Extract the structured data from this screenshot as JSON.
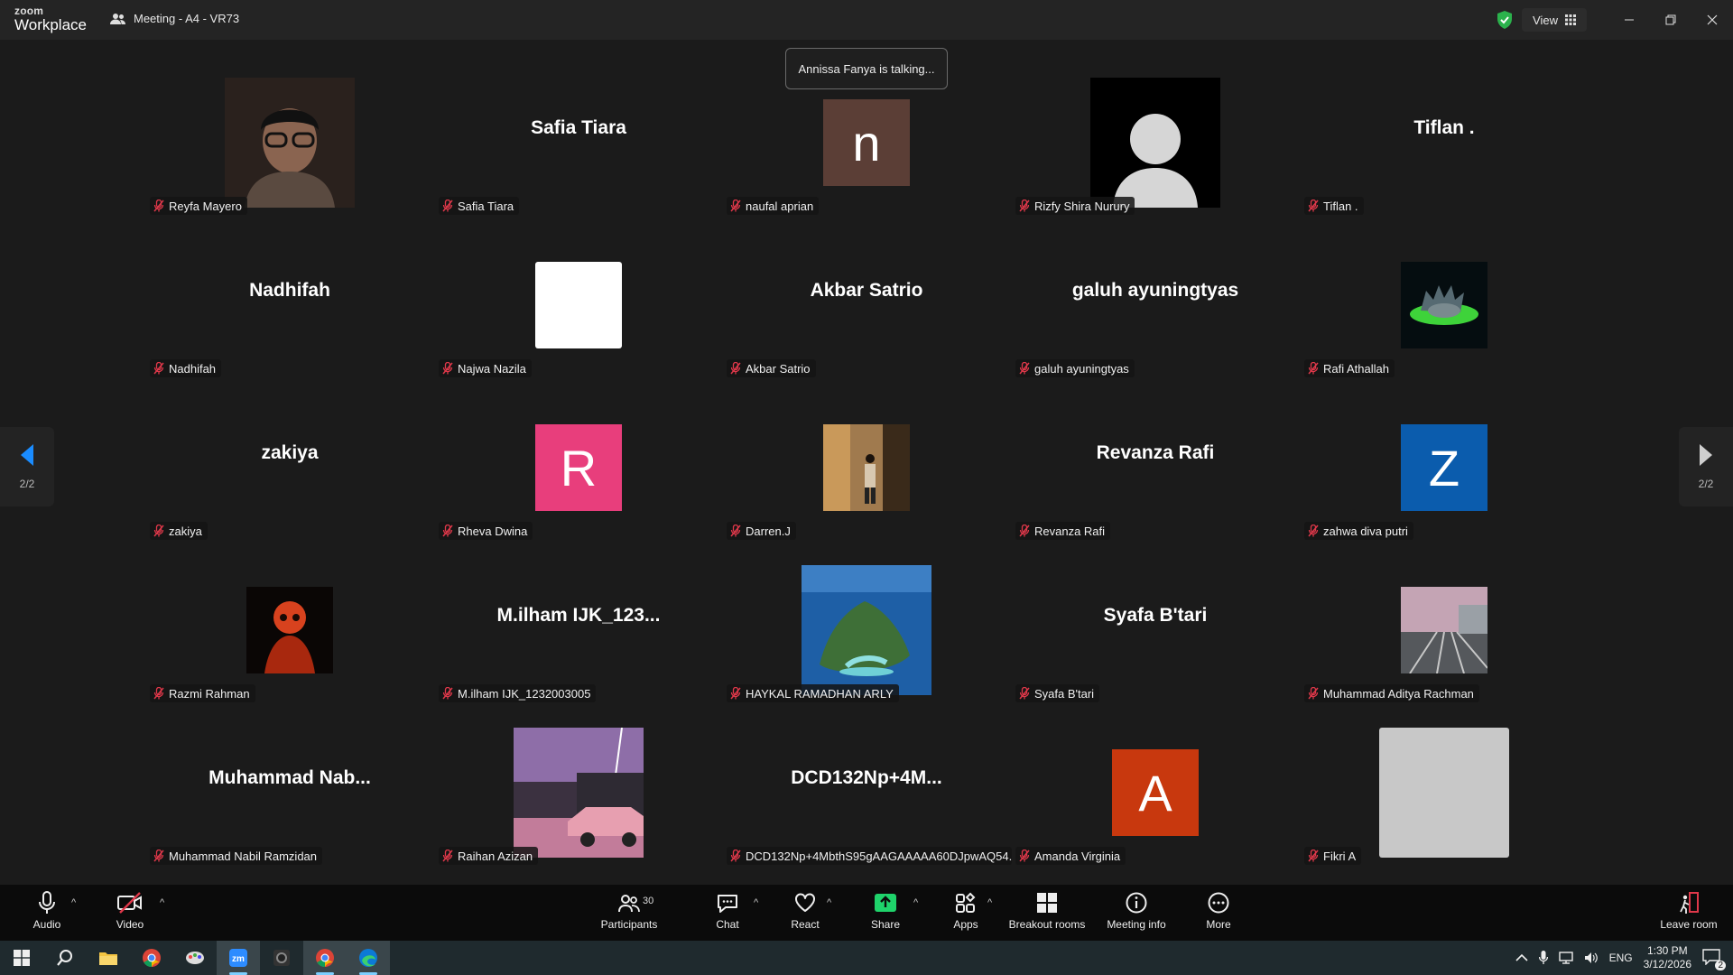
{
  "titlebar": {
    "brand_top": "zoom",
    "brand_bottom": "Workplace",
    "meeting_title": "Meeting - A4 - VR73",
    "view_label": "View",
    "shield_color": "#2bb24c"
  },
  "toast": "Annissa Fanya is talking...",
  "pager": {
    "left": "2/2",
    "right": "2/2",
    "arrow_color": "#1a8cff"
  },
  "tiles": [
    {
      "label": "Reyfa Mayero",
      "display": "",
      "kind": "photo-face"
    },
    {
      "label": "Safia Tiara",
      "display": "Safia Tiara",
      "kind": "name"
    },
    {
      "label": "naufal aprian",
      "display": "n",
      "kind": "letter",
      "color": "#5b3e36"
    },
    {
      "label": "Rizfy Shira Nurury",
      "display": "",
      "kind": "default-avatar"
    },
    {
      "label": "Tiflan .",
      "display": "Tiflan .",
      "kind": "name"
    },
    {
      "label": "Nadhifah",
      "display": "Nadhifah",
      "kind": "name"
    },
    {
      "label": "Najwa Nazila",
      "display": "",
      "kind": "white"
    },
    {
      "label": "Akbar Satrio",
      "display": "Akbar Satrio",
      "kind": "name"
    },
    {
      "label": "galuh ayuningtyas",
      "display": "galuh ayuningtyas",
      "kind": "name"
    },
    {
      "label": "Rafi Athallah",
      "display": "",
      "kind": "photo-rick"
    },
    {
      "label": "zakiya",
      "display": "zakiya",
      "kind": "name"
    },
    {
      "label": "Rheva Dwina",
      "display": "R",
      "kind": "letter",
      "color": "#e83e7c"
    },
    {
      "label": "Darren.J",
      "display": "",
      "kind": "photo-room"
    },
    {
      "label": "Revanza Rafi",
      "display": "Revanza Rafi",
      "kind": "name"
    },
    {
      "label": "zahwa diva putri",
      "display": "Z",
      "kind": "letter",
      "color": "#0b5cad"
    },
    {
      "label": "Razmi Rahman",
      "display": "",
      "kind": "photo-red"
    },
    {
      "label": "M.ilham IJK_1232003005",
      "display": "M.ilham  IJK_123...",
      "kind": "name"
    },
    {
      "label": "HAYKAL RAMADHAN ARLY",
      "display": "",
      "kind": "photo-island"
    },
    {
      "label": "Syafa B'tari",
      "display": "Syafa B'tari",
      "kind": "name"
    },
    {
      "label": "Muhammad Aditya Rachman",
      "display": "",
      "kind": "photo-rail"
    },
    {
      "label": "Muhammad Nabil Ramzidan",
      "display": "Muhammad  Nab...",
      "kind": "name"
    },
    {
      "label": "Raihan Azizan",
      "display": "",
      "kind": "photo-car"
    },
    {
      "label": "DCD132Np+4MbthS95gAAGAAAAA60DJpwAQ54...",
      "display": "DCD132Np+4M...",
      "kind": "name"
    },
    {
      "label": "Amanda Virginia",
      "display": "A",
      "kind": "letter",
      "color": "#c8380e"
    },
    {
      "label": "Fikri A",
      "display": "",
      "kind": "gray"
    }
  ],
  "toolbar": {
    "audio": "Audio",
    "video": "Video",
    "participants": "Participants",
    "participants_count": "30",
    "chat": "Chat",
    "react": "React",
    "share": "Share",
    "apps": "Apps",
    "breakout": "Breakout rooms",
    "meeting_info": "Meeting info",
    "more": "More",
    "leave": "Leave room",
    "share_color": "#1fd36b",
    "video_off_color": "#e0384a"
  },
  "taskbar": {
    "lang": "ENG",
    "time": "1:30 PM",
    "date": "3/12/2026",
    "notifications": "2"
  }
}
